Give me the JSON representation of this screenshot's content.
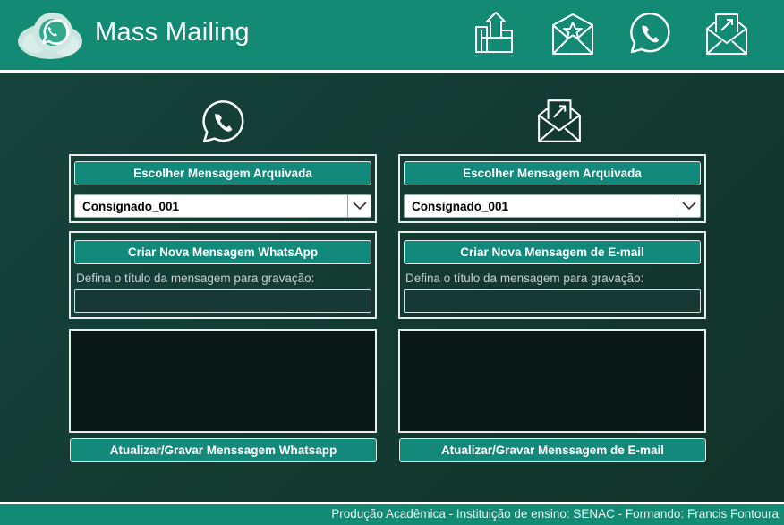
{
  "app": {
    "title": "Mass Mailing"
  },
  "header_icons": [
    "upload-icon",
    "starred-mail-icon",
    "whatsapp-icon",
    "send-mail-icon"
  ],
  "whatsapp_column": {
    "icon": "whatsapp-icon",
    "choose_archived_label": "Escolher Mensagem Arquivada",
    "selected_message": "Consignado_001",
    "create_new_label": "Criar Nova Mensagem WhatsApp",
    "title_prompt": "Defina o título da mensagem para gravação:",
    "title_value": "",
    "message_body": "",
    "save_label": "Atualizar/Gravar Menssagem Whatsapp"
  },
  "email_column": {
    "icon": "send-mail-icon",
    "choose_archived_label": "Escolher Mensagem Arquivada",
    "selected_message": "Consignado_001",
    "create_new_label": "Criar Nova Mensagem de E-mail",
    "title_prompt": "Defina o título da mensagem para gravação:",
    "title_value": "",
    "message_body": "",
    "save_label": "Atualizar/Gravar Menssagem de E-mail"
  },
  "footer": {
    "text": "Produção Acadêmica - Instituição de ensino: SENAC - Formando: Francis Fontoura"
  },
  "colors": {
    "header": "#128a74",
    "background": "#163a33",
    "button": "#12897a",
    "message_box": "#0a1816"
  }
}
